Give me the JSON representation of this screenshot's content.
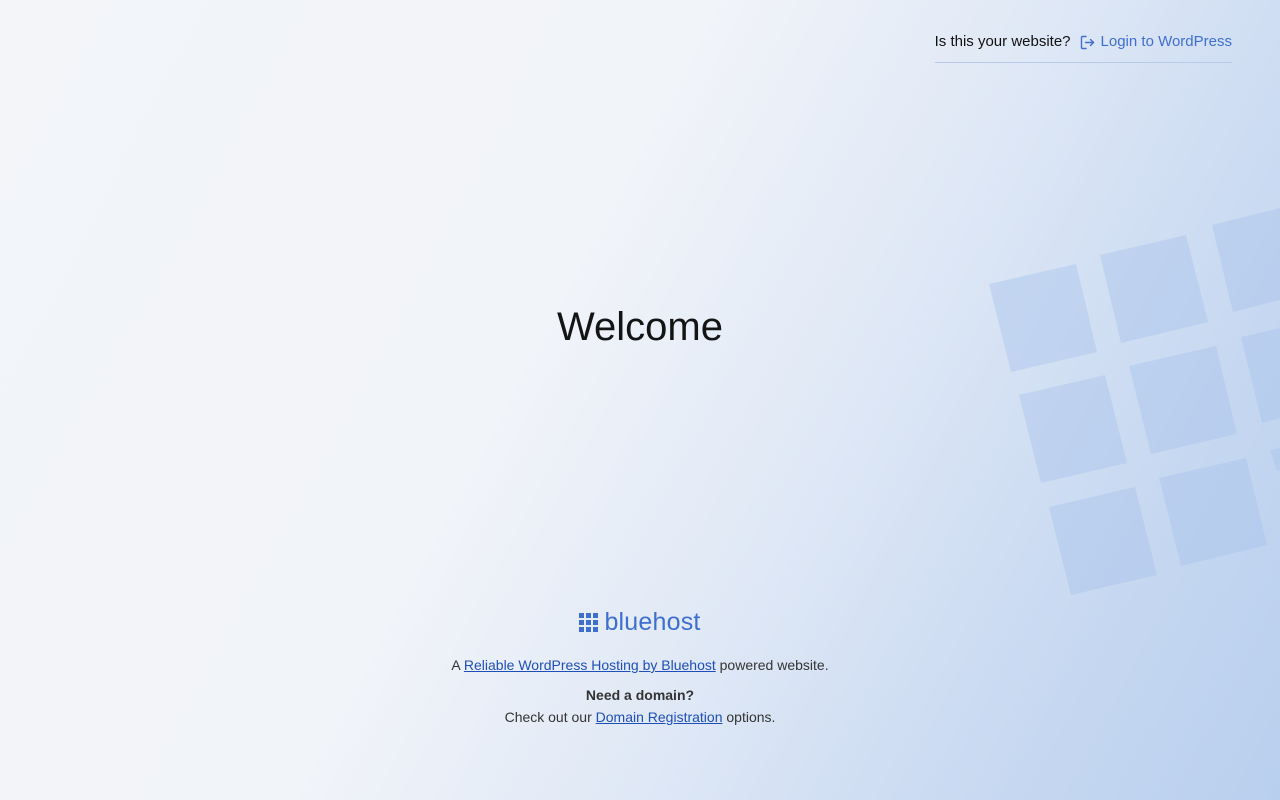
{
  "header": {
    "question": "Is this your website?",
    "login_label": "Login to WordPress",
    "login_icon": "login-icon"
  },
  "main": {
    "heading": "Welcome"
  },
  "footer": {
    "brand_icon": "bluehost-grid-icon",
    "brand_name": "bluehost",
    "tagline_prefix": "A",
    "tagline_link": "Reliable WordPress Hosting by Bluehost",
    "tagline_suffix": "powered website.",
    "need_domain": "Need a domain?",
    "domain_prefix": "Check out our",
    "domain_link": "Domain Registration",
    "domain_suffix": "options."
  },
  "colors": {
    "accent": "#3f6fd1",
    "link": "#1e4fb6",
    "tile": "#b7cdee"
  }
}
